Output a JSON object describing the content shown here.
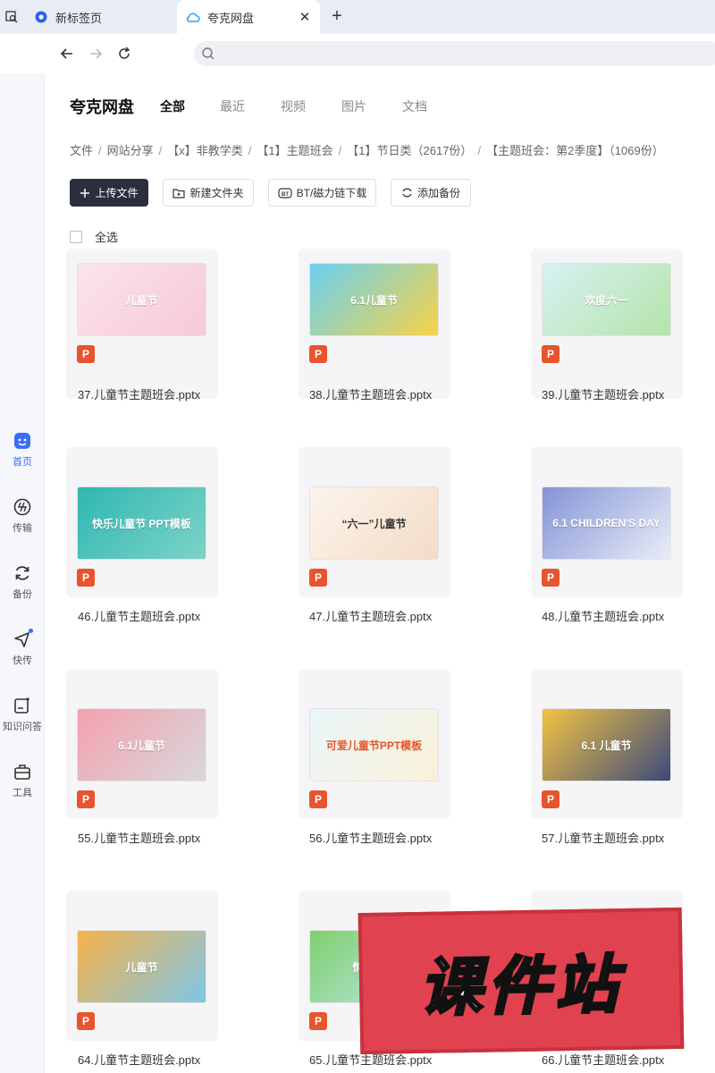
{
  "browser": {
    "tabs": [
      {
        "title": "新标签页"
      },
      {
        "title": "夸克网盘"
      }
    ],
    "new_tab_label": "+"
  },
  "rail": {
    "items": [
      {
        "label": "首页",
        "icon": "home-icon",
        "active": true
      },
      {
        "label": "传输",
        "icon": "transfer-icon"
      },
      {
        "label": "备份",
        "icon": "backup-icon"
      },
      {
        "label": "快传",
        "icon": "quick-send-icon"
      },
      {
        "label": "知识问答",
        "icon": "qa-icon"
      },
      {
        "label": "工具",
        "icon": "tools-icon"
      }
    ]
  },
  "header": {
    "brand": "夸克网盘",
    "tabs": [
      {
        "label": "全部",
        "active": true
      },
      {
        "label": "最近"
      },
      {
        "label": "视频"
      },
      {
        "label": "图片"
      },
      {
        "label": "文档"
      }
    ]
  },
  "breadcrumb": [
    "文件",
    "网站分享",
    "【x】非教学类",
    "【1】主题班会",
    "【1】节日类（2617份）",
    "【主题班会：第2季度】（1069份）"
  ],
  "actions": {
    "upload": "上传文件",
    "new_folder": "新建文件夹",
    "bt_download": "BT/磁力链下载",
    "add_backup": "添加备份"
  },
  "select_all": "全选",
  "file_badge": "P",
  "files": [
    {
      "name": "37.儿童节主题班会.pptx",
      "thumb_text": "儿童节",
      "colors": [
        "#fbe3ec",
        "#f7c9d8"
      ]
    },
    {
      "name": "38.儿童节主题班会.pptx",
      "thumb_text": "6.1儿童节",
      "colors": [
        "#6ad0f0",
        "#f7d348"
      ]
    },
    {
      "name": "39.儿童节主题班会.pptx",
      "thumb_text": "欢度六一",
      "colors": [
        "#d8f1f4",
        "#b4e4a8"
      ]
    },
    {
      "name": "46.儿童节主题班会.pptx",
      "thumb_text": "快乐儿童节 PPT模板",
      "colors": [
        "#2fb7b1",
        "#7dd3c8"
      ]
    },
    {
      "name": "47.儿童节主题班会.pptx",
      "thumb_text": "“六一”儿童节",
      "colors": [
        "#fdf4ec",
        "#f2dcc6"
      ]
    },
    {
      "name": "48.儿童节主题班会.pptx",
      "thumb_text": "6.1 CHILDREN'S DAY",
      "colors": [
        "#8494d6",
        "#e9edf8"
      ]
    },
    {
      "name": "55.儿童节主题班会.pptx",
      "thumb_text": "6.1儿童节",
      "colors": [
        "#f4a0ad",
        "#d8d8dc"
      ]
    },
    {
      "name": "56.儿童节主题班会.pptx",
      "thumb_text": "可爱儿童节PPT模板",
      "colors": [
        "#eaf6fb",
        "#f9f1d8"
      ]
    },
    {
      "name": "57.儿童节主题班会.pptx",
      "thumb_text": "6.1 儿童节",
      "colors": [
        "#f4c342",
        "#3b4a7a"
      ]
    },
    {
      "name": "64.儿童节主题班会.pptx",
      "thumb_text": "儿童节",
      "colors": [
        "#f7b24b",
        "#7fc6e6"
      ]
    },
    {
      "name": "65.儿童节主题班会.pptx",
      "thumb_text": "情暖童心",
      "colors": [
        "#7fd06a",
        "#bfe7f5"
      ]
    },
    {
      "name": "66.儿童节主题班会.pptx",
      "thumb_text": "",
      "colors": [
        "#f5e3d0",
        "#eab7a0"
      ]
    }
  ],
  "watermark": "课件站",
  "colors": {
    "accent": "#3b6cf6",
    "primary_button": "#2b2f3d",
    "ppt_badge": "#e8542d",
    "watermark": "#e0424f"
  }
}
